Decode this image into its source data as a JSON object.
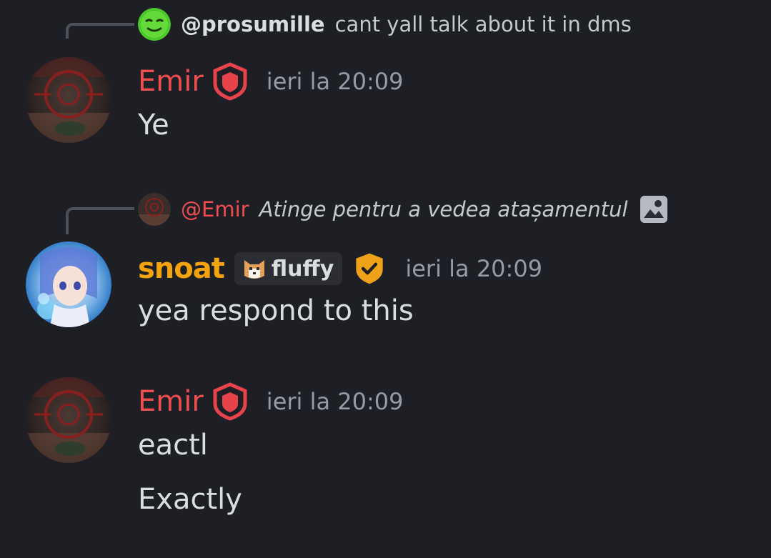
{
  "colors": {
    "background": "#1e1f24",
    "emir_name": "#f04d50",
    "snoat_name": "#f3a30d",
    "timestamp": "#949ba4",
    "reply_line": "#4e5058"
  },
  "messages": [
    {
      "reply": {
        "author": "@prosumille",
        "text": "cant yall talk about it in dms",
        "avatar_icon": "green-smiley-avatar"
      },
      "author": "Emir",
      "badge_icon": "red-shield-icon",
      "timestamp": "ieri la 20:09",
      "lines": [
        "Ye"
      ]
    },
    {
      "reply": {
        "author": "@Emir",
        "text": "Atinge pentru a vedea atașamentul",
        "avatar_icon": "emir-avatar",
        "attachment_icon": "image-icon"
      },
      "author": "snoat",
      "tag": {
        "label": "fluffy",
        "icon": "cat-icon"
      },
      "badge_icon": "orange-verified-shield-icon",
      "timestamp": "ieri la 20:09",
      "lines": [
        "yea respond to this"
      ]
    },
    {
      "author": "Emir",
      "badge_icon": "red-shield-icon",
      "timestamp": "ieri la 20:09",
      "lines": [
        "eactl",
        "Exactly"
      ]
    }
  ]
}
